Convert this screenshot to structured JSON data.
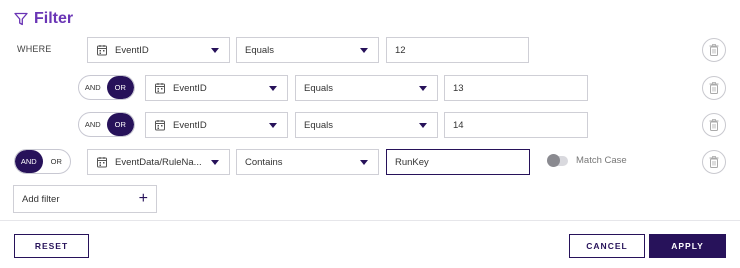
{
  "header": {
    "title": "Filter"
  },
  "where_label": "WHERE",
  "toggle": {
    "and_label": "AND",
    "or_label": "OR"
  },
  "rows": [
    {
      "connector": null,
      "field": "EventID",
      "operator": "Equals",
      "value": "12"
    },
    {
      "connector": "OR",
      "field": "EventID",
      "operator": "Equals",
      "value": "13"
    },
    {
      "connector": "OR",
      "field": "EventID",
      "operator": "Equals",
      "value": "14"
    },
    {
      "connector": "AND",
      "field": "EventData/RuleNa...",
      "operator": "Contains",
      "value": "RunKey"
    }
  ],
  "match_case": {
    "label": "Match Case",
    "enabled": false
  },
  "add_filter": {
    "label": "Add filter"
  },
  "footer": {
    "reset_label": "RESET",
    "cancel_label": "CANCEL",
    "apply_label": "APPLY"
  },
  "colors": {
    "accent": "#6a35b5",
    "primary": "#27125a"
  },
  "icons": {
    "header": "funnel-icon",
    "field": "calendar-icon",
    "delete": "trash-icon",
    "add": "plus-icon"
  }
}
